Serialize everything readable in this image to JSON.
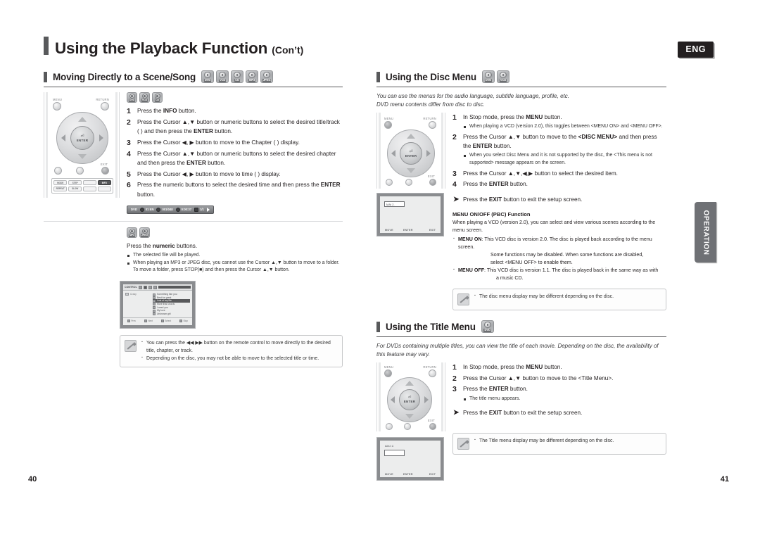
{
  "page": {
    "main_title": "Using the Playback Function",
    "main_title_suffix": "(Con’t)",
    "language_badge": "ENG",
    "side_tab": "OPERATION",
    "page_number_left": "40",
    "page_number_right": "41"
  },
  "disc_icons": {
    "dvd": "DVD",
    "vcd": "VCD",
    "cd": "CD",
    "mp3": "MP3",
    "jpeg": "JPEG"
  },
  "left": {
    "section_title": "Moving Directly to a Scene/Song",
    "section_discs": [
      "DVD",
      "VCD",
      "CD",
      "MP3",
      "JPEG"
    ],
    "group1_discs": [
      "DVD",
      "VCD",
      "CD"
    ],
    "steps": [
      {
        "num": "1",
        "text_a": "Press the ",
        "bold_a": "INFO",
        "text_b": " button."
      },
      {
        "num": "2",
        "text_a": "Press the Cursor ▲,▼ button or numeric buttons to select the desired title/track (  ) and then press the ",
        "bold_a": "ENTER",
        "text_b": " button."
      },
      {
        "num": "3",
        "text_a": "Press the Cursor ◀, ▶ button to move to the Chapter (  ) display.",
        "bold_a": "",
        "text_b": ""
      },
      {
        "num": "4",
        "text_a": "Press the Cursor ▲,▼ button or numeric buttons to select the desired chapter and then press the ",
        "bold_a": "ENTER",
        "text_b": " button."
      },
      {
        "num": "5",
        "text_a": "Press the Cursor ◀, ▶ button to move to time (  ) display.",
        "bold_a": "",
        "text_b": ""
      },
      {
        "num": "6",
        "text_a": "Press the numeric buttons to select the desired time and then press the ",
        "bold_a": "ENTER",
        "text_b": " button."
      }
    ],
    "osd": {
      "disc": "DVD",
      "title": "01 EN",
      "chapter": "001/048",
      "time": "0:00:37",
      "extra": "1/1"
    },
    "group2_discs": [
      "MP3",
      "JPEG"
    ],
    "group2_line_a": "Press the ",
    "group2_line_bold": "numeric",
    "group2_line_b": " buttons.",
    "group2_bullets": [
      "The selected file will be played.",
      "When playing an MP3 or JPEG disc, you cannot use the Cursor ▲,▼ button to move to a folder. To move a folder, press STOP(■) and then press the Cursor ▲,▼ button."
    ],
    "mp3_screen": {
      "header_tag": "CONTROL",
      "header_right": "MUSIC LIST",
      "left_label": "Crazy",
      "tracks": [
        "Something like you",
        "Best for great",
        "Lost of my life",
        "More than words",
        "I need you",
        "My love",
        "Unknown girl"
      ],
      "selected_track_index": 2,
      "footer": [
        "Prev",
        "Next",
        "Select",
        "Stop"
      ]
    },
    "tips": [
      "You can press the ◀◀ ▶▶ button on the remote control to move directly to the desired title, chapter, or track.",
      "Depending on the disc, you may not be able to move to the selected title or time."
    ]
  },
  "right": {
    "disc_menu": {
      "section_title": "Using the Disc Menu",
      "section_discs": [
        "DVD",
        "VCD"
      ],
      "intro_line1": "You can use the menus for the audio language, subtitle language, profile, etc.",
      "intro_line2": "DVD menu contents differ from disc to disc.",
      "steps": [
        {
          "num": "1",
          "text_a": "In Stop mode, press the ",
          "bold_a": "MENU",
          "text_b": " button."
        },
        {
          "num": "2",
          "text_a": "Press the Cursor ▲,▼ button to move to the ",
          "bold_a": "<DISC MENU>",
          "text_b": " and then press the ",
          "bold_b": "ENTER",
          "text_c": " button."
        },
        {
          "num": "3",
          "text_a": "Press the Cursor ▲,▼,◀,▶ button to select the desired item.",
          "bold_a": "",
          "text_b": ""
        },
        {
          "num": "4",
          "text_a": "Press the ",
          "bold_a": "ENTER",
          "text_b": " button."
        }
      ],
      "step1_bullet": "When playing a VCD (version 2.0), this toggles between <MENU ON> and <MENU OFF>.",
      "step2_bullet": "When you select Disc Menu and it is not supported by the disc, the <This menu is not supported> message appears on the screen.",
      "exit_note_a": "Press the ",
      "exit_note_bold": "EXIT",
      "exit_note_b": " button to exit the setup screen.",
      "pbc_title": "MENU ON/OFF (PBC) Function",
      "pbc_intro": "When playing a VCD (version 2.0), you can select and view various scenes according to the menu screen.",
      "pbc_on_label": "MENU ON",
      "pbc_on_line1": ": This VCD disc is version 2.0. The disc is played back according to the menu screen.",
      "pbc_on_line2": "Some functions may be disabled. When some functions are disabled,",
      "pbc_on_line3": "select <MENU OFF> to enable them.",
      "pbc_off_label": "MENU OFF",
      "pbc_off_line1": ": This VCD disc is version 1.1. The disc is played back in the same way as with",
      "pbc_off_line2": "a music CD.",
      "tip": "The disc menu display may be different depending on the disc.",
      "screen_label": "MAI 2."
    },
    "title_menu": {
      "section_title": "Using the Title Menu",
      "section_discs": [
        "DVD"
      ],
      "intro": "For DVDs containing multiple titles, you can view the title of each movie. Depending on the disc, the availability of this feature may vary.",
      "steps": [
        {
          "num": "1",
          "text_a": "In Stop mode, press the ",
          "bold_a": "MENU",
          "text_b": " button."
        },
        {
          "num": "2",
          "text_a": "Press the Cursor ▲,▼ button to move to the <Title Menu>.",
          "bold_a": "",
          "text_b": ""
        },
        {
          "num": "3",
          "text_a": "Press the ",
          "bold_a": "ENTER",
          "text_b": " button."
        }
      ],
      "step3_bullet": "The title menu appears.",
      "exit_note_a": "Press the ",
      "exit_note_bold": "EXIT",
      "exit_note_b": " button to exit the setup screen.",
      "tip": "The Title menu display may be different depending on the disc.",
      "screen_label": "ADIJ 2."
    }
  },
  "remote": {
    "menu_label": "MENU",
    "return_label": "RETURN",
    "exit_label": "EXIT",
    "enter_label": "ENTER",
    "keys_row1": [
      "MODE",
      "STEP",
      "",
      "INFO"
    ],
    "keys_row2": [
      "REPEAT",
      "SLOW",
      "",
      ""
    ],
    "highlight_key": "INFO"
  },
  "tv_footer_labels": {
    "move": "MOVE",
    "enter": "ENTER",
    "exit": "EXIT"
  }
}
